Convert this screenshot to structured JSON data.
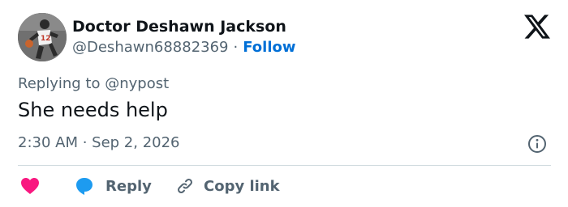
{
  "author": {
    "display_name": "Doctor Deshawn Jackson",
    "handle": "@Deshawn68882369",
    "separator": "·",
    "follow_label": "Follow"
  },
  "tweet": {
    "replying_prefix": "Replying to",
    "replying_to": "@nypost",
    "text": "She needs help",
    "timestamp": "2:30 AM · Sep 2, 2026"
  },
  "actions": {
    "reply_label": "Reply",
    "copy_link_label": "Copy link"
  },
  "icons": {
    "brand": "x-logo-icon",
    "info": "info-icon",
    "like": "heart-icon",
    "reply": "speech-bubble-icon",
    "copy": "link-icon"
  },
  "colors": {
    "text_primary": "#0f1419",
    "text_secondary": "#536471",
    "follow_blue": "#006fd6",
    "heart_pink": "#f91880",
    "reply_blue": "#1d9bf0",
    "divider": "#cfd9de"
  }
}
